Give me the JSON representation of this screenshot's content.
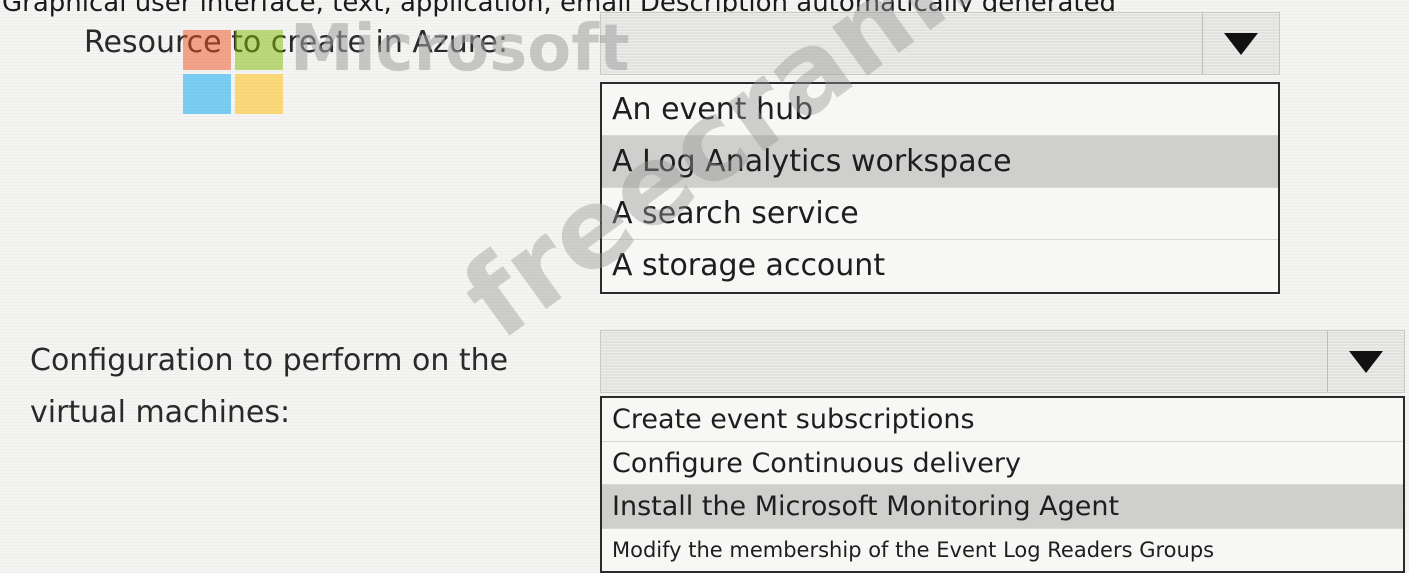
{
  "caption": "Graphical user interface, text, application, email Description automatically generated",
  "question1": {
    "label": "Resource to create in Azure:",
    "selected": "",
    "options": [
      {
        "label": "An event hub",
        "selected": false
      },
      {
        "label": "A Log Analytics workspace",
        "selected": true
      },
      {
        "label": "A search service",
        "selected": false
      },
      {
        "label": "A storage account",
        "selected": false
      }
    ]
  },
  "question2": {
    "label_line1": "Configuration to perform on the",
    "label_line2": "virtual machines:",
    "selected": "",
    "options": [
      {
        "label": "Create event subscriptions",
        "selected": false
      },
      {
        "label": "Configure Continuous delivery",
        "selected": false
      },
      {
        "label": "Install the Microsoft Monitoring Agent",
        "selected": true
      },
      {
        "label": "Modify the membership of the Event Log Readers Groups",
        "selected": false
      }
    ]
  },
  "watermark": {
    "brand": "Microsoft",
    "site": "freecram.net",
    "logo_colors": [
      "#f25022",
      "#7fba00",
      "#00a4ef",
      "#ffb900"
    ]
  },
  "icons": {
    "dropdown": "triangle-down-icon",
    "logo": "microsoft-logo-icon"
  }
}
